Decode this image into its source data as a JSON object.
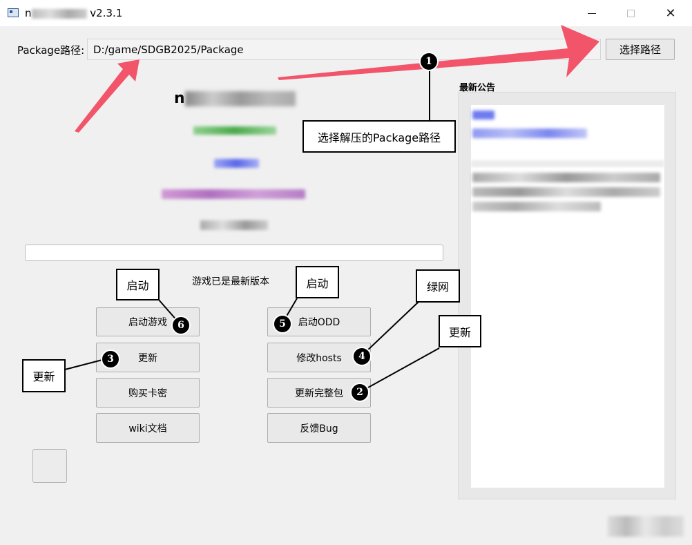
{
  "window": {
    "title_prefix": "n",
    "title_version": "v2.3.1",
    "minimize_glyph": "",
    "close_glyph": "✕"
  },
  "path_bar": {
    "label": "Package路径:",
    "value": "D:/game/SDGB2025/Package",
    "select_button": "选择路径"
  },
  "main": {
    "app_name_prefix": "n",
    "status_text": "游戏已是最新版本"
  },
  "buttons": {
    "start_game": "启动游戏",
    "update": "更新",
    "buy_key": "购买卡密",
    "wiki": "wiki文档",
    "start_odd": "启动ODD",
    "modify_hosts": "修改hosts",
    "update_full": "更新完整包",
    "feedback": "反馈Bug"
  },
  "notice": {
    "title": "最新公告"
  },
  "annotations": {
    "callouts": {
      "select_path": "选择解压的Package路径",
      "start_left": "启动",
      "start_right": "启动",
      "green_net": "绿网",
      "update_right": "更新",
      "update_left": "更新"
    },
    "markers": [
      "1",
      "2",
      "3",
      "4",
      "5",
      "6"
    ],
    "arrow_color": "#f2546a"
  }
}
